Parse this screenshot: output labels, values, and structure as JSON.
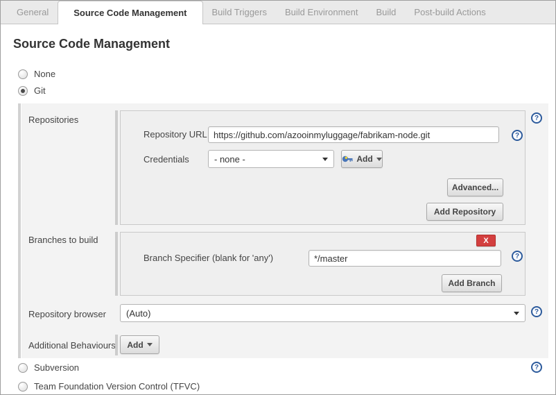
{
  "tabs": [
    {
      "label": "General",
      "active": false
    },
    {
      "label": "Source Code Management",
      "active": true
    },
    {
      "label": "Build Triggers",
      "active": false
    },
    {
      "label": "Build Environment",
      "active": false
    },
    {
      "label": "Build",
      "active": false
    },
    {
      "label": "Post-build Actions",
      "active": false
    }
  ],
  "heading": "Source Code Management",
  "scm": {
    "none_label": "None",
    "git_label": "Git",
    "subversion_label": "Subversion",
    "tfvc_label": "Team Foundation Version Control (TFVC)"
  },
  "git": {
    "repositories": {
      "label": "Repositories",
      "url_label": "Repository URL",
      "url_value": "https://github.com/azooinmyluggage/fabrikam-node.git",
      "credentials_label": "Credentials",
      "credentials_value": "- none -",
      "add_button": "Add",
      "advanced_button": "Advanced...",
      "add_repository_button": "Add Repository"
    },
    "branches": {
      "label": "Branches to build",
      "delete_button": "X",
      "specifier_label": "Branch Specifier (blank for 'any')",
      "specifier_value": "*/master",
      "add_branch_button": "Add Branch"
    },
    "browser": {
      "label": "Repository browser",
      "value": "(Auto)"
    },
    "behaviours": {
      "label": "Additional Behaviours",
      "add_button": "Add"
    }
  },
  "icons": {
    "help_glyph": "?"
  },
  "colors": {
    "delete_red": "#d33f3f",
    "help_blue": "#2d5b9c",
    "section_bg": "#f3f3f3",
    "panel_bg": "#efefef"
  }
}
